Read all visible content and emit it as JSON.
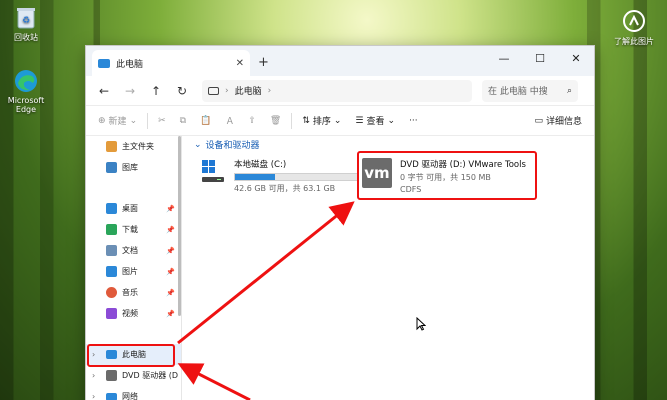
{
  "desktop": {
    "recycle_bin": "回收站",
    "edge": "Microsoft Edge",
    "learn": "了解此图片"
  },
  "window": {
    "tab_title": "此电脑",
    "navbar": {
      "path": "此电脑",
      "search_placeholder": "在 此电脑 中搜"
    },
    "toolbar": {
      "new_label": "新建",
      "sort_label": "排序",
      "view_label": "查看",
      "details_label": "详细信息"
    },
    "sidebar": {
      "quick": [
        {
          "label": "主文件夹",
          "color": "#e39b3b"
        },
        {
          "label": "图库",
          "color": "#3b82c4"
        }
      ],
      "pinned": [
        {
          "label": "桌面",
          "color": "#2b88d8"
        },
        {
          "label": "下载",
          "color": "#2aa55a"
        },
        {
          "label": "文档",
          "color": "#6b8fb5"
        },
        {
          "label": "图片",
          "color": "#2b88d8"
        },
        {
          "label": "音乐",
          "color": "#e05a3b"
        },
        {
          "label": "视频",
          "color": "#8b4bd6"
        }
      ],
      "tree": [
        {
          "label": "此电脑"
        },
        {
          "label": "DVD 驱动器 (D"
        },
        {
          "label": "网络"
        }
      ]
    },
    "content": {
      "group_title": "设备和驱动器",
      "drive_c": {
        "name": "本地磁盘 (C:)",
        "size": "42.6 GB 可用，共 63.1 GB",
        "used_fraction": 0.325
      },
      "drive_d": {
        "name": "DVD 驱动器 (D:) VMware Tools",
        "size": "0 字节 可用，共 150 MB",
        "fs": "CDFS",
        "logo": "vm"
      }
    }
  },
  "annotations": {
    "highlight_color": "#e11111"
  }
}
